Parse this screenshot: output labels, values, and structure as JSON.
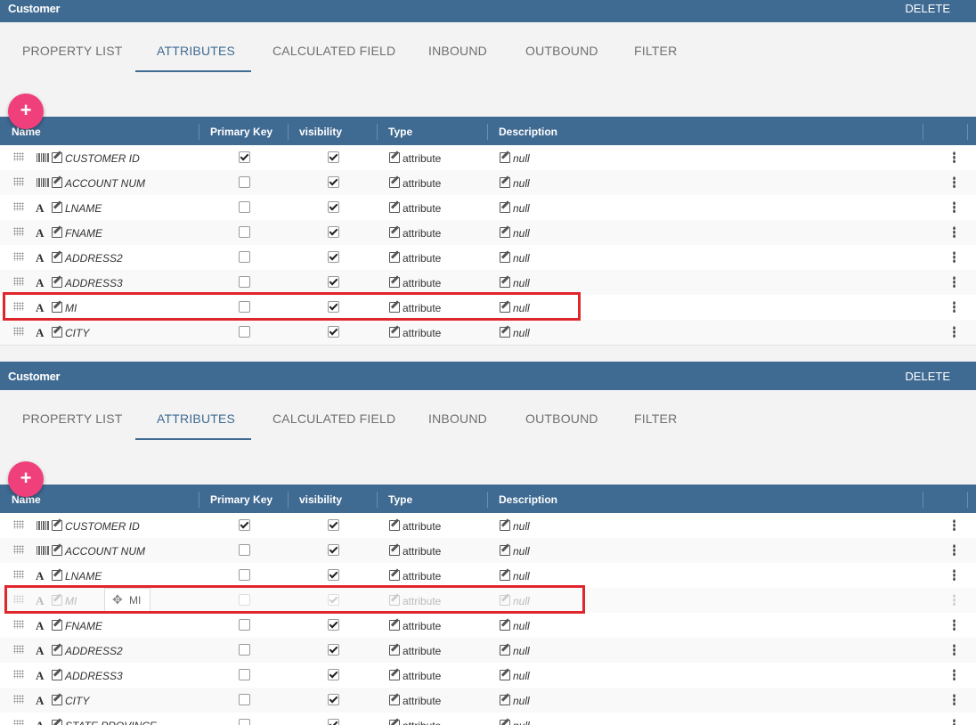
{
  "panels": [
    {
      "title": "Customer",
      "delete_label": "DELETE",
      "tabs": [
        "PROPERTY LIST",
        "ATTRIBUTES",
        "CALCULATED FIELD",
        "INBOUND",
        "OUTBOUND",
        "FILTER"
      ],
      "active_tab": "ATTRIBUTES",
      "add_label": "+",
      "columns": [
        "Name",
        "Primary Key",
        "visibility",
        "Type",
        "Description"
      ],
      "rows": [
        {
          "icon": "barcode-icon",
          "name": "CUSTOMER ID",
          "pk": true,
          "vis": true,
          "type": "attribute",
          "desc": "null"
        },
        {
          "icon": "barcode-icon",
          "name": "ACCOUNT NUM",
          "pk": false,
          "vis": true,
          "type": "attribute",
          "desc": "null"
        },
        {
          "icon": "text-type-icon",
          "glyph": "A",
          "name": "LNAME",
          "pk": false,
          "vis": true,
          "type": "attribute",
          "desc": "null"
        },
        {
          "icon": "text-type-icon",
          "glyph": "A",
          "name": "FNAME",
          "pk": false,
          "vis": true,
          "type": "attribute",
          "desc": "null"
        },
        {
          "icon": "text-type-icon",
          "glyph": "A",
          "name": "ADDRESS2",
          "pk": false,
          "vis": true,
          "type": "attribute",
          "desc": "null"
        },
        {
          "icon": "text-type-icon",
          "glyph": "A",
          "name": "ADDRESS3",
          "pk": false,
          "vis": true,
          "type": "attribute",
          "desc": "null"
        },
        {
          "icon": "text-type-icon",
          "glyph": "A",
          "name": "MI",
          "pk": false,
          "vis": true,
          "type": "attribute",
          "desc": "null",
          "highlight": true
        },
        {
          "icon": "text-type-icon",
          "glyph": "A",
          "name": "CITY",
          "pk": false,
          "vis": true,
          "type": "attribute",
          "desc": "null"
        }
      ]
    },
    {
      "title": "Customer",
      "delete_label": "DELETE",
      "tabs": [
        "PROPERTY LIST",
        "ATTRIBUTES",
        "CALCULATED FIELD",
        "INBOUND",
        "OUTBOUND",
        "FILTER"
      ],
      "active_tab": "ATTRIBUTES",
      "add_label": "+",
      "columns": [
        "Name",
        "Primary Key",
        "visibility",
        "Type",
        "Description"
      ],
      "rows": [
        {
          "icon": "barcode-icon",
          "name": "CUSTOMER ID",
          "pk": true,
          "vis": true,
          "type": "attribute",
          "desc": "null"
        },
        {
          "icon": "barcode-icon",
          "name": "ACCOUNT NUM",
          "pk": false,
          "vis": true,
          "type": "attribute",
          "desc": "null"
        },
        {
          "icon": "text-type-icon",
          "glyph": "A",
          "name": "LNAME",
          "pk": false,
          "vis": true,
          "type": "attribute",
          "desc": "null"
        },
        {
          "icon": "text-type-icon",
          "glyph": "A",
          "name": "MI",
          "pk": false,
          "vis": true,
          "type": "attribute",
          "desc": "null",
          "ghost": true,
          "drag_label": "MI",
          "highlight": true
        },
        {
          "icon": "text-type-icon",
          "glyph": "A",
          "name": "FNAME",
          "pk": false,
          "vis": true,
          "type": "attribute",
          "desc": "null"
        },
        {
          "icon": "text-type-icon",
          "glyph": "A",
          "name": "ADDRESS2",
          "pk": false,
          "vis": true,
          "type": "attribute",
          "desc": "null"
        },
        {
          "icon": "text-type-icon",
          "glyph": "A",
          "name": "ADDRESS3",
          "pk": false,
          "vis": true,
          "type": "attribute",
          "desc": "null"
        },
        {
          "icon": "text-type-icon",
          "glyph": "A",
          "name": "CITY",
          "pk": false,
          "vis": true,
          "type": "attribute",
          "desc": "null"
        },
        {
          "icon": "text-type-icon",
          "glyph": "A",
          "name": "STATE PROVINCE",
          "pk": false,
          "vis": true,
          "type": "attribute",
          "desc": "null"
        }
      ]
    }
  ],
  "colors": {
    "header": "#3f6a92",
    "accent": "#f0407c",
    "highlight": "#e0262d"
  }
}
